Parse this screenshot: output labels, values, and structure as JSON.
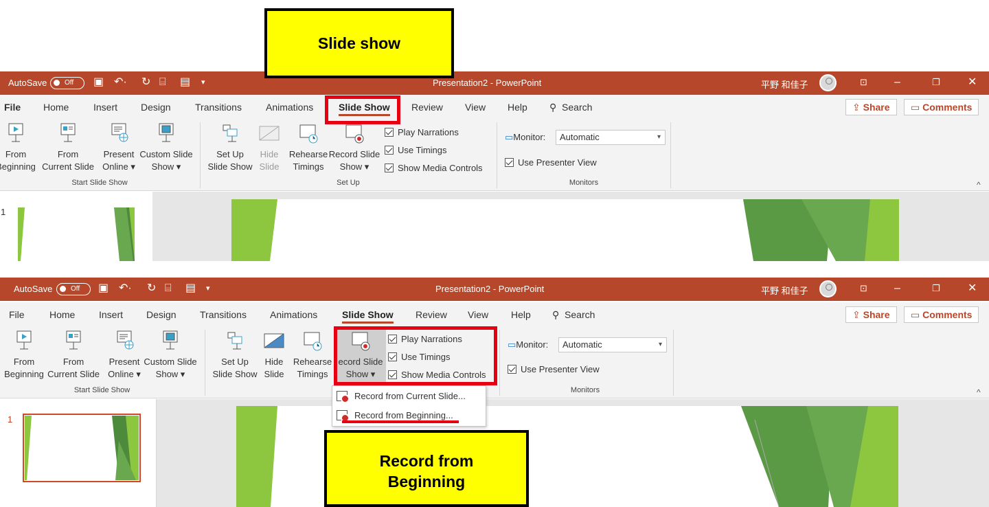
{
  "callouts": {
    "top": "Slide show",
    "bottom_line1": "Record from",
    "bottom_line2": "Beginning"
  },
  "colors": {
    "accent": "#b7472a",
    "highlight": "#e60012",
    "callout_bg": "#ffff00",
    "slide_green": "#8dc63f"
  },
  "titlebar": {
    "autosave": "AutoSave",
    "toggle": "Off",
    "title": "Presentation2  -  PowerPoint",
    "user": "平野 和佳子"
  },
  "tabs": [
    "File",
    "Home",
    "Insert",
    "Design",
    "Transitions",
    "Animations",
    "Slide Show",
    "Review",
    "View",
    "Help"
  ],
  "search": "Search",
  "share": "Share",
  "comments": "Comments",
  "ribbon": {
    "from_beginning": [
      "From",
      "Beginning"
    ],
    "from_current": [
      "From",
      "Current Slide"
    ],
    "present_online": [
      "Present",
      "Online ▾"
    ],
    "custom_show": [
      "Custom Slide",
      "Show ▾"
    ],
    "start_group": "Start Slide Show",
    "setup": [
      "Set Up",
      "Slide Show"
    ],
    "hide": [
      "Hide",
      "Slide"
    ],
    "rehearse": [
      "Rehearse",
      "Timings"
    ],
    "record": [
      "Record Slide",
      "Show ▾"
    ],
    "record_clipped": [
      "ecord Slide",
      "Show ▾"
    ],
    "rehearse_clipped": [
      "Rehearse",
      "Timings"
    ],
    "play_narrations": "Play Narrations",
    "use_timings": "Use Timings",
    "media_controls": "Show Media Controls",
    "setup_group": "Set Up",
    "monitor_label": "Monitor:",
    "monitor_value": "Automatic",
    "presenter_view": "Use Presenter View",
    "monitors_group": "Monitors"
  },
  "slide_number": "1",
  "dropdown": {
    "item1": "Record from Current Slide...",
    "item2": "Record from Beginning..."
  }
}
